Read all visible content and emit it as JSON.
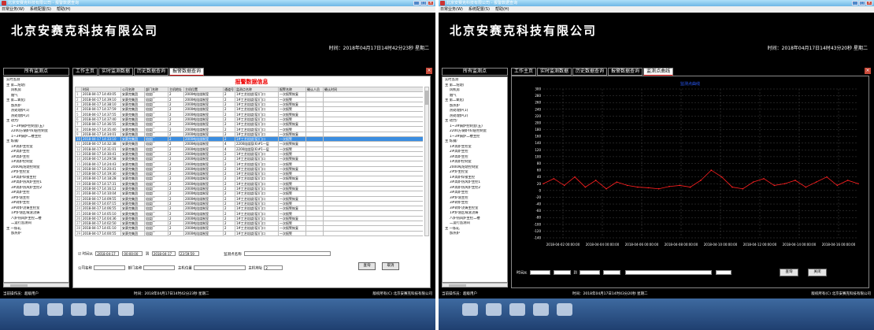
{
  "window_title": "北京安赛克科技有限公司 - 报警数据查询",
  "menu": [
    "日常业务(W)",
    "系统配置(S)",
    "帮助(H)"
  ],
  "company": "北京安赛克科技有限公司",
  "left": {
    "clock": "时间：2018年04月17日14时42分23秒 星期二",
    "sidebar_title": "所有监测点",
    "tabs": [
      "工作主页",
      "实时监测数据",
      "历史数据查询",
      "报警数据查询"
    ],
    "table_title": "报警数据信息",
    "columns": [
      "",
      "时间",
      "公司名称",
      "部门名称",
      "主机地址",
      "主机位置",
      "通道号",
      "监测点名称",
      "报警名称",
      "确认人员",
      "确认时间"
    ],
    "rows": [
      [
        "1",
        "2018-04-17 14:40:05",
        "安赛克集团",
        "焙烧厂",
        "2",
        "2000吨焙烧制室",
        "2",
        "1#工艺焙烧(窑)门口",
        "一次报警恢复",
        "",
        ""
      ],
      [
        "2",
        "2018-04-17 14:39:10",
        "安赛克集团",
        "焙烧厂",
        "2",
        "2000吨焙烧制室",
        "2",
        "1#工艺焙烧(窑)门口",
        "一次报警",
        "",
        ""
      ],
      [
        "3",
        "2018-04-17 14:38:10",
        "安赛克集团",
        "焙烧厂",
        "2",
        "2000吨焙烧制室",
        "2",
        "1#工艺焙烧(窑)门口",
        "一次报警恢复",
        "",
        ""
      ],
      [
        "4",
        "2018-04-17 14:37:59",
        "安赛克集团",
        "焙烧厂",
        "2",
        "2000吨焙烧制室",
        "2",
        "1#工艺焙烧(窑)门口",
        "一次报警",
        "",
        ""
      ],
      [
        "5",
        "2018-04-17 14:37:55",
        "安赛克集团",
        "焙烧厂",
        "2",
        "2000吨焙烧制室",
        "2",
        "1#工艺焙烧(窑)门口",
        "一次报警恢复",
        "",
        ""
      ],
      [
        "6",
        "2018-04-17 14:37:40",
        "安赛克集团",
        "焙烧厂",
        "2",
        "2000吨焙烧制室",
        "2",
        "1#工艺焙烧(窑)门口",
        "一次报警",
        "",
        ""
      ],
      [
        "7",
        "2018-04-17 14:36:55",
        "安赛克集团",
        "焙烧厂",
        "2",
        "2000吨焙烧制室",
        "2",
        "1#工艺焙烧(窑)门口",
        "一次报警恢复",
        "",
        ""
      ],
      [
        "8",
        "2018-04-17 14:35:40",
        "安赛克集团",
        "焙烧厂",
        "2",
        "2000吨焙烧制室",
        "2",
        "1#工艺焙烧(窑)门口",
        "一次报警",
        "",
        ""
      ],
      [
        "9",
        "2018-04-17 14:34:01",
        "安赛克集团",
        "焙烧厂",
        "2",
        "2000吨焙烧制室",
        "2",
        "1#工艺焙烧(窑)门口",
        "一次报警恢复",
        "",
        ""
      ],
      [
        "10",
        "2018-04-17 14:33:10",
        "安赛克集团",
        "焙烧厂",
        "2",
        "2000吨焙烧制室",
        "2",
        "1#工艺焙烧(窑)门口",
        "一次报警",
        "",
        ""
      ],
      [
        "11",
        "2018-04-17 14:32:38",
        "安赛克集团",
        "焙烧厂",
        "2",
        "2000吨焙烧制室",
        "4",
        "2200焙烧窑(6)#1一层",
        "一次报警恢复",
        "",
        ""
      ],
      [
        "12",
        "2018-04-17 14:31:01",
        "安赛克集团",
        "焙烧厂",
        "2",
        "2000吨焙烧制室",
        "4",
        "2200焙烧窑(6)#1一层",
        "一次报警",
        "",
        ""
      ],
      [
        "13",
        "2018-04-17 14:30:41",
        "安赛克集团",
        "焙烧厂",
        "2",
        "2000吨焙烧制室",
        "2",
        "1#工艺焙烧(窑)门口",
        "一次报警",
        "",
        ""
      ],
      [
        "14",
        "2018-04-17 14:29:58",
        "安赛克集团",
        "焙烧厂",
        "2",
        "2000吨焙烧制室",
        "2",
        "1#工艺焙烧(窑)门口",
        "一次报警恢复",
        "",
        ""
      ],
      [
        "15",
        "2018-04-17 14:24:43",
        "安赛克集团",
        "焙烧厂",
        "2",
        "2000吨焙烧制室",
        "2",
        "1#工艺焙烧(窑)门口",
        "一次报警",
        "",
        ""
      ],
      [
        "16",
        "2018-04-17 14:20:41",
        "安赛克集团",
        "焙烧厂",
        "2",
        "2000吨焙烧制室",
        "2",
        "1#工艺焙烧(窑)门口",
        "一次报警恢复",
        "",
        ""
      ],
      [
        "17",
        "2018-04-17 14:19:30",
        "安赛克集团",
        "焙烧厂",
        "2",
        "2000吨焙烧制室",
        "2",
        "1#工艺焙烧(窑)门口",
        "一次报警",
        "",
        ""
      ],
      [
        "18",
        "2018-04-17 14:18:28",
        "安赛克集团",
        "焙烧厂",
        "2",
        "2000吨焙烧制室",
        "2",
        "1#工艺焙烧(窑)门口",
        "一次报警恢复",
        "",
        ""
      ],
      [
        "19",
        "2018-04-17 14:17:31",
        "安赛克集团",
        "焙烧厂",
        "2",
        "2000吨焙烧制室",
        "2",
        "1#工艺焙烧(窑)门口",
        "一次报警",
        "",
        ""
      ],
      [
        "20",
        "2018-04-17 14:16:12",
        "安赛克集团",
        "焙烧厂",
        "2",
        "2000吨焙烧制室",
        "2",
        "1#工艺焙烧(窑)门口",
        "一次报警恢复",
        "",
        ""
      ],
      [
        "21",
        "2018-04-17 14:10:04",
        "安赛克集团",
        "焙烧厂",
        "2",
        "2000吨焙烧制室",
        "2",
        "1#工艺焙烧(窑)门口",
        "一次报警",
        "",
        ""
      ],
      [
        "22",
        "2018-04-17 14:09:55",
        "安赛克集团",
        "焙烧厂",
        "2",
        "2000吨焙烧制室",
        "2",
        "1#工艺焙烧(窑)门口",
        "一次报警恢复",
        "",
        ""
      ],
      [
        "23",
        "2018-04-17 14:07:15",
        "安赛克集团",
        "焙烧厂",
        "2",
        "2000吨焙烧制室",
        "2",
        "1#工艺焙烧(窑)门口",
        "一次报警",
        "",
        ""
      ],
      [
        "24",
        "2018-04-17 14:06:55",
        "安赛克集团",
        "焙烧厂",
        "2",
        "2000吨焙烧制室",
        "2",
        "1#工艺焙烧(窑)门口",
        "一次报警恢复",
        "",
        ""
      ],
      [
        "25",
        "2018-04-17 14:05:10",
        "安赛克集团",
        "焙烧厂",
        "2",
        "2000吨焙烧制室",
        "2",
        "1#工艺焙烧(窑)门口",
        "一次报警",
        "",
        ""
      ],
      [
        "26",
        "2018-04-17 14:04:36",
        "安赛克集团",
        "焙烧厂",
        "2",
        "2000吨焙烧制室",
        "2",
        "1#工艺焙烧(窑)门口",
        "一次报警恢复",
        "",
        ""
      ],
      [
        "27",
        "2018-04-17 14:02:50",
        "安赛克集团",
        "焙烧厂",
        "2",
        "2000吨焙烧制室",
        "2",
        "1#工艺焙烧(窑)门口",
        "一次报警",
        "",
        ""
      ],
      [
        "28",
        "2018-04-17 14:01:10",
        "安赛克集团",
        "焙烧厂",
        "2",
        "2000吨焙烧制室",
        "2",
        "1#工艺焙烧(窑)门口",
        "一次报警恢复",
        "",
        ""
      ],
      [
        "29",
        "2018-04-17 14:00:55",
        "安赛克集团",
        "焙烧厂",
        "2",
        "2000吨焙烧制室",
        "2",
        "1#工艺焙烧(窑)门口",
        "一次报警",
        "",
        ""
      ]
    ],
    "selected_row": 9,
    "filters": {
      "time_label": "时间从",
      "date_from": "2018-04-17",
      "time_from": "00:00:00",
      "to_label": "到",
      "date_to": "2018-04-17",
      "time_to": "23:59:59",
      "point_label": "监测点名称",
      "company_label": "公司名称",
      "dept_label": "部门名称",
      "host_pos_label": "主机位置",
      "host_addr_label": "主机地址",
      "host_addr_value": "2"
    },
    "query_button": "查询",
    "cancel_button": "取消",
    "status": {
      "user": "当前操作员：超级用户",
      "time": "时间：2018年04月17日14时42分23秒  星期二",
      "copyright": "版权所有(C)  北京安赛克科技有限公司"
    }
  },
  "tree": [
    "实时监测",
    "主 第二焙烧厂",
    "  风机房",
    "  烟气",
    "主 第二氧化厂",
    "  加热炉",
    "  热处理炉(1)",
    "  热处理炉(2)",
    "主 动力厂",
    "  1~3#锅炉控制室(五)",
    "  2200方锅炉(6)层控制室",
    "  1~3#锅炉二楼主控",
    "主 炼钢厂",
    "  1#高炉主控室",
    "  2#高炉主控",
    "  3#高炉主控",
    "  1#高炉控制室",
    "  2000吨焙烧控制室",
    "  2#炉主控室",
    "  1#高炉焊接主控",
    "  3#高炉热风炉主控1",
    "  3#高炉热风炉主控2",
    "  3#高炉主控",
    "  3#炉渣主控",
    "  3#转炉主控",
    "  3#转炉浇铸主控室",
    "  1#炉渣区域渣浇铸",
    "  八炉热风炉主控二楼",
    "  二运行监测间",
    "主 一炼轧",
    "  加热炉"
  ],
  "right": {
    "clock": "时间：2018年04月17日14时43分20秒 星期二",
    "tabs": [
      "工作主页",
      "实时监测数据",
      "历史数据查询",
      "报警数据查询",
      "监测点曲线"
    ],
    "chart_title": "监测点曲线",
    "controls": {
      "time_label": "时间从",
      "date_from": "2017-05-06",
      "time_from": "21:55:47",
      "to_label": "到",
      "date_to": "2017-05-06",
      "time_to": "21:55:47",
      "query": "查询",
      "close": "关闭"
    },
    "status": {
      "user": "当前操作员：超级用户",
      "time": "时间：2018年04月17日14时43分20秒  星期二",
      "copyright": "版权所有(C)  北京安赛克科技有限公司"
    }
  },
  "chart_data": {
    "type": "line",
    "title": "监测点曲线",
    "ylim": [
      -140,
      300
    ],
    "yticks": [
      300,
      280,
      260,
      240,
      220,
      200,
      180,
      160,
      140,
      120,
      100,
      80,
      60,
      40,
      20,
      0,
      -20,
      -40,
      -60,
      -80,
      -100,
      -120,
      -140
    ],
    "xticks": [
      "2018-04-02 00:00:00",
      "2018-04-04 00:00:00",
      "2018-04-06 00:00:00",
      "2018-04-08 00:00:00",
      "2018-04-10 00:00:00",
      "2018-04-12 00:00:00",
      "2018-04-14 00:00:00",
      "2018-04-16 00:00:00"
    ],
    "series": [
      {
        "color": "#ff2020",
        "x_days": [
          0,
          0.5,
          1,
          1.5,
          2,
          2.5,
          3,
          3.5,
          4,
          4.5,
          5,
          5.5,
          6,
          6.5,
          7,
          7.5,
          8,
          8.5,
          9,
          9.5,
          10,
          10.5,
          11,
          11.5,
          12,
          12.5,
          13,
          13.5,
          14,
          14.5,
          15
        ],
        "values": [
          20,
          35,
          15,
          40,
          10,
          30,
          5,
          25,
          15,
          10,
          8,
          5,
          12,
          15,
          10,
          30,
          60,
          40,
          10,
          5,
          25,
          35,
          15,
          20,
          30,
          10,
          25,
          40,
          15,
          30,
          20
        ]
      }
    ],
    "grid": true
  }
}
